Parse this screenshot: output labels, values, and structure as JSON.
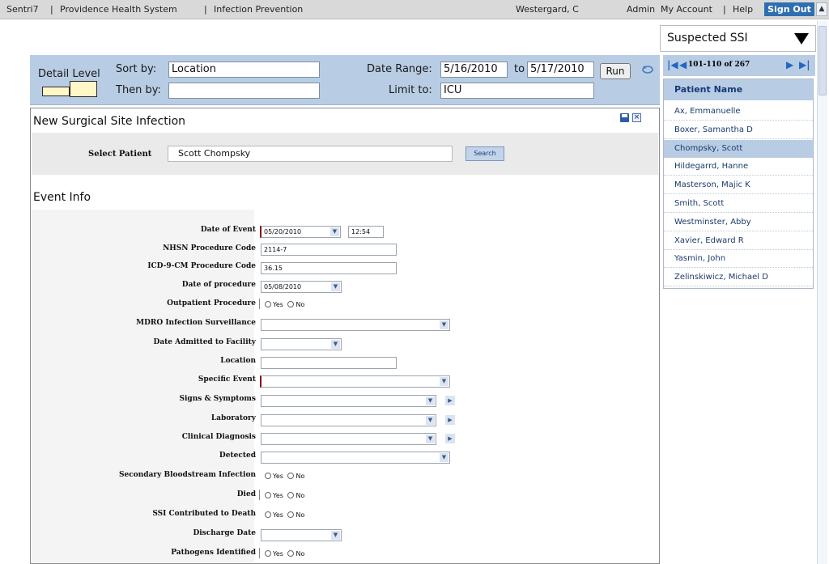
{
  "topbar": {
    "crumbs": [
      "Sentri7",
      "Providence Health System",
      "Infection Prevention"
    ],
    "user": "Westergard, C",
    "admin": "Admin",
    "my_account": "My Account",
    "help": "Help",
    "sign_out": "Sign Out"
  },
  "filters": {
    "detail_level_label": "Detail Level",
    "sort_by_label": "Sort by:",
    "sort_by_value": "Location",
    "then_by_label": "Then by:",
    "then_by_value": "",
    "date_range_label": "Date Range:",
    "date_from": "5/16/2010",
    "to_label": "to",
    "date_to": "5/17/2010",
    "run_label": "Run",
    "limit_label": "Limit to:",
    "limit_value": "ICU"
  },
  "form": {
    "title": "New Surgical Site Infection",
    "select_patient_label": "Select Patient",
    "patient_value": "Scott Chompsky",
    "search_label": "Search",
    "event_info_title": "Event Info",
    "fields": {
      "date_of_event": {
        "label": "Date of Event",
        "value": "05/20/2010",
        "time": "12:54"
      },
      "nhsn_code": {
        "label": "NHSN Procedure Code",
        "value": "2114-7"
      },
      "icd9_code": {
        "label": "ICD-9-CM Procedure Code",
        "value": "36.15"
      },
      "date_of_procedure": {
        "label": "Date of procedure",
        "value": "05/08/2010"
      },
      "outpatient": {
        "label": "Outpatient Procedure"
      },
      "mdro": {
        "label": "MDRO Infection Surveillance"
      },
      "date_admitted": {
        "label": "Date Admitted to Facility"
      },
      "location": {
        "label": "Location"
      },
      "specific_event": {
        "label": "Specific Event"
      },
      "signs_symptoms": {
        "label": "Signs & Symptoms"
      },
      "laboratory": {
        "label": "Laboratory"
      },
      "clinical_diagnosis": {
        "label": "Clinical Diagnosis"
      },
      "detected": {
        "label": "Detected"
      },
      "secondary_bsi": {
        "label": "Secondary Bloodstream Infection"
      },
      "died": {
        "label": "Died"
      },
      "ssi_death": {
        "label": "SSI Contributed to Death"
      },
      "discharge_date": {
        "label": "Discharge Date"
      },
      "pathogens": {
        "label": "Pathogens Identified"
      }
    },
    "yes_label": "Yes",
    "no_label": "No"
  },
  "right": {
    "status_value": "Suspected SSI",
    "page_range": "101-110 of 267",
    "list_header": "Patient Name",
    "patients": [
      "Ax, Emmanuelle",
      "Boxer, Samantha D",
      "Chompsky, Scott",
      "Hildegarrd, Hanne",
      "Masterson, Majic K",
      "Smith, Scott",
      "Westminster, Abby",
      "Xavier, Edward R",
      "Yasmin, John",
      "Zelinskiwicz, Michael D"
    ],
    "selected_index": 2
  },
  "colors": {
    "accent_blue": "#2f6fb0",
    "panel_blue": "#b8cde4",
    "required_marker": "#8b0000"
  }
}
